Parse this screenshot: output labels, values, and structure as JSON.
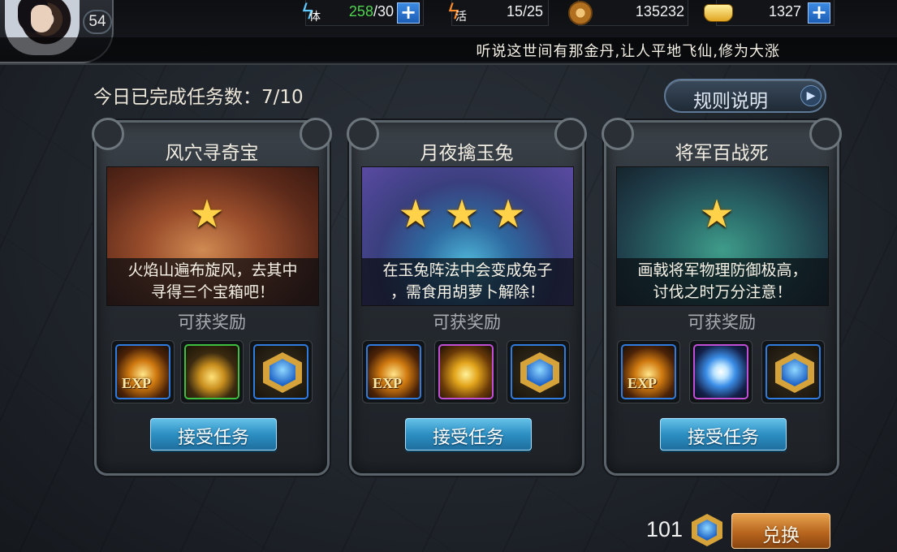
{
  "player": {
    "level": "54"
  },
  "resources": {
    "stamina": {
      "icon": "lightning-stamina-icon",
      "label": "体",
      "current": "258",
      "max": "/30"
    },
    "vitality": {
      "icon": "flame-vitality-icon",
      "label": "活",
      "value": "15/25"
    },
    "copper": {
      "icon": "copper-coin-icon",
      "value": "135232"
    },
    "gold": {
      "icon": "gold-ingot-icon",
      "value": "1327"
    }
  },
  "ticker": "听说这世间有那金丹,让人平地飞仙,修为大涨",
  "completed_text": "今日已完成任务数：7/10",
  "rules_button": "规则说明",
  "reward_label": "可获奖励",
  "accept_label": "接受任务",
  "missions": [
    {
      "title": "风穴寻奇宝",
      "stars": 1,
      "desc_line1": "火焰山遍布旋风，去其中",
      "desc_line2": "寻得三个宝箱吧！",
      "rewards": [
        "exp-icon",
        "gold-coins-icon",
        "blue-gem-icon"
      ]
    },
    {
      "title": "月夜擒玉兔",
      "stars": 3,
      "desc_line1": "在玉兔阵法中会变成兔子",
      "desc_line2": "，需食用胡萝卜解除！",
      "rewards": [
        "exp-icon",
        "gold-bag-icon",
        "blue-gem-icon"
      ]
    },
    {
      "title": "将军百战死",
      "stars": 1,
      "desc_line1": "画戟将军物理防御极高，",
      "desc_line2": "讨伐之时万分注意！",
      "rewards": [
        "exp-icon",
        "spirit-orb-icon",
        "blue-gem-icon"
      ]
    }
  ],
  "exp_text": "EXP",
  "currency": {
    "amount": "101",
    "icon": "blue-gem-icon"
  },
  "exchange_button": "兑换",
  "colors": {
    "star": "#ffd24a",
    "accept": "#2c8fc2",
    "exchange": "#b8661e",
    "stamina_value": "#4fd44f"
  }
}
